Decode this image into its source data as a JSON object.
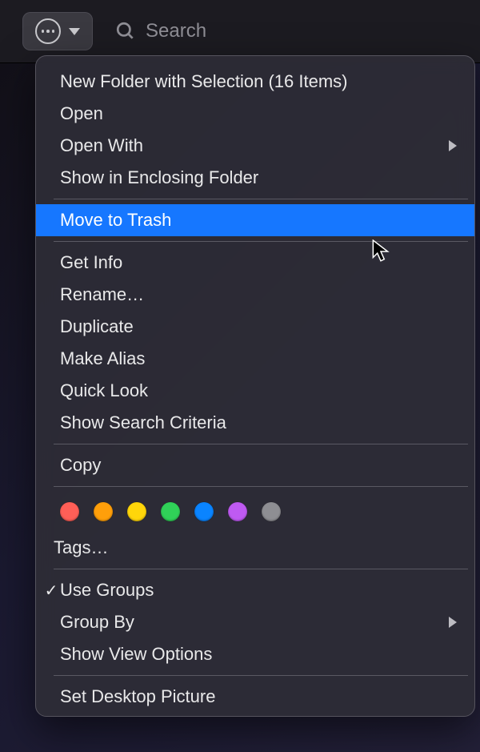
{
  "toolbar": {
    "search_placeholder": "Search"
  },
  "menu": {
    "group1": [
      {
        "label": "New Folder with Selection (16 Items)"
      },
      {
        "label": "Open"
      },
      {
        "label": "Open With",
        "submenu": true
      },
      {
        "label": "Show in Enclosing Folder"
      }
    ],
    "moveToTrash": {
      "label": "Move to Trash"
    },
    "group2": [
      {
        "label": "Get Info"
      },
      {
        "label": "Rename…"
      },
      {
        "label": "Duplicate"
      },
      {
        "label": "Make Alias"
      },
      {
        "label": "Quick Look"
      },
      {
        "label": "Show Search Criteria"
      }
    ],
    "copy": {
      "label": "Copy"
    },
    "tagColors": [
      "#ff5f57",
      "#ff9f0a",
      "#ffd60a",
      "#30d158",
      "#0a84ff",
      "#bf5af2",
      "#8e8e93"
    ],
    "tagsLabel": "Tags…",
    "group3": [
      {
        "label": "Use Groups",
        "checked": true
      },
      {
        "label": "Group By",
        "submenu": true
      },
      {
        "label": "Show View Options"
      }
    ],
    "setDesktop": {
      "label": "Set Desktop Picture"
    }
  }
}
